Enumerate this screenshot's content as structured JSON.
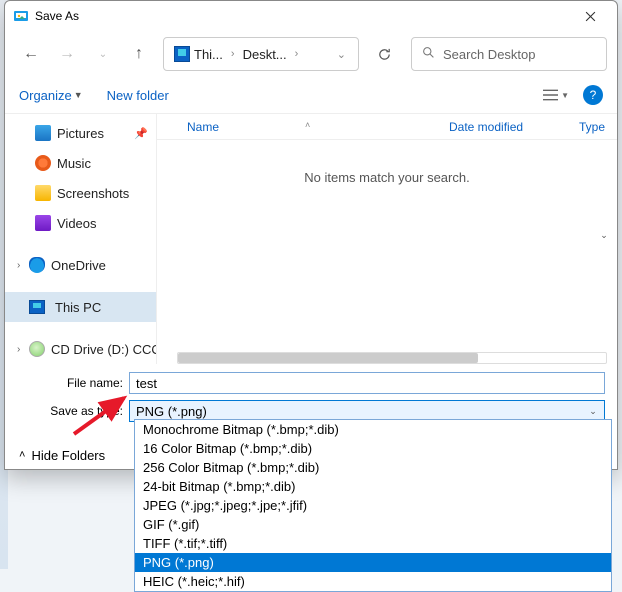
{
  "window": {
    "title": "Save As"
  },
  "nav": {
    "breadcrumb": {
      "seg1": "Thi...",
      "seg2": "Deskt..."
    },
    "search_placeholder": "Search Desktop"
  },
  "toolbar": {
    "organize": "Organize",
    "newfolder": "New folder"
  },
  "tree": {
    "pictures": "Pictures",
    "music": "Music",
    "screenshots": "Screenshots",
    "videos": "Videos",
    "onedrive": "OneDrive",
    "thispc": "This PC",
    "cddrive": "CD Drive (D:) CCO"
  },
  "columns": {
    "name": "Name",
    "date": "Date modified",
    "type": "Type"
  },
  "empty_msg": "No items match your search.",
  "fields": {
    "filename_label": "File name:",
    "filename_value": "test",
    "type_label": "Save as type:",
    "type_value": "PNG (*.png)"
  },
  "hide": "Hide Folders",
  "filetypes": [
    "Monochrome Bitmap (*.bmp;*.dib)",
    "16 Color Bitmap (*.bmp;*.dib)",
    "256 Color Bitmap (*.bmp;*.dib)",
    "24-bit Bitmap (*.bmp;*.dib)",
    "JPEG (*.jpg;*.jpeg;*.jpe;*.jfif)",
    "GIF (*.gif)",
    "TIFF (*.tif;*.tiff)",
    "PNG (*.png)",
    "HEIC (*.heic;*.hif)"
  ]
}
